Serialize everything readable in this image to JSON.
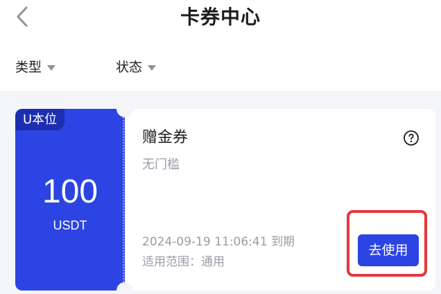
{
  "header": {
    "title": "卡券中心",
    "back_icon": "chevron-left-icon"
  },
  "filters": [
    {
      "label": "类型",
      "icon": "caret-down-icon"
    },
    {
      "label": "状态",
      "icon": "caret-down-icon"
    }
  ],
  "coupon": {
    "tag": "U本位",
    "amount": "100",
    "currency": "USDT",
    "name": "赠金券",
    "threshold": "无门槛",
    "help_icon": "question-circle-icon",
    "expire": "2024-09-19 11:06:41 到期",
    "scope": "适用范围：通用",
    "use_label": "去使用"
  },
  "colors": {
    "accent": "#2c44e3",
    "tag_bg": "#1c2fb0",
    "highlight": "#e5363d",
    "list_bg": "#f4f5f9"
  }
}
